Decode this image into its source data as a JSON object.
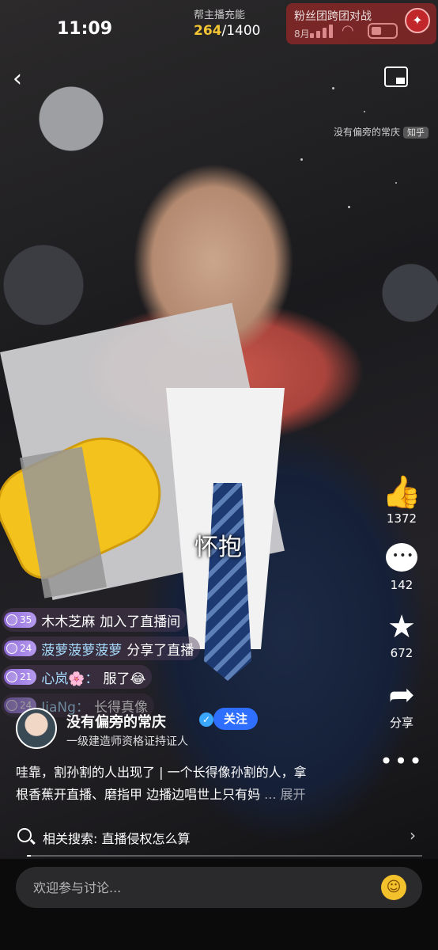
{
  "status_bar": {
    "time": "11:09"
  },
  "live_top": {
    "fuel_label": "帮主播充能",
    "fuel_current": "264",
    "fuel_total": "/1400",
    "fan_battle_label": "粉丝团跨团对战",
    "fan_battle_date": "8月",
    "anchor_watermark": "没有偏旁的常庆",
    "platform_tag": "知乎"
  },
  "subtitle": "怀抱",
  "actions": {
    "like_count": "1372",
    "comment_count": "142",
    "favorite_count": "672",
    "share_label": "分享",
    "more_label": "•••"
  },
  "chat": [
    {
      "level": "35",
      "name": "木木芝麻",
      "text": "加入了直播间",
      "type": "sys"
    },
    {
      "level": "24",
      "name": "菠萝菠萝菠萝",
      "text": "分享了直播",
      "type": "user"
    },
    {
      "level": "21",
      "name": "心岚🌸：",
      "text": "服了😂",
      "type": "user"
    },
    {
      "level": "24",
      "name": "JiaNg：",
      "text": "长得真像",
      "type": "user"
    }
  ],
  "host": {
    "name": "没有偏旁的常庆",
    "follow_label": "关注",
    "subtitle": "一级建造师资格证持证人"
  },
  "description": {
    "line1": "哇靠，割孙割的人出现了 | 一个长得像孙割的人，拿",
    "line2": "根香蕉开直播、磨指甲 边播边唱世上只有妈",
    "more": " ... 展开"
  },
  "search": {
    "label": "相关搜索: 直播侵权怎么算"
  },
  "progress": {
    "value": 0.01
  },
  "comment_input": {
    "placeholder": "欢迎参与讨论..."
  }
}
